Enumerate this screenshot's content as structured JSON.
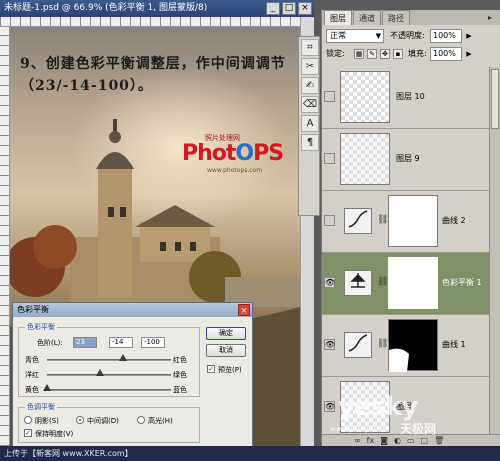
{
  "document": {
    "title": "未标题-1.psd @ 66.9% (色彩平衡 1, 图层蒙版/8)",
    "minimize": "_",
    "maximize": "□",
    "close": "×",
    "caption": "9、创建色彩平衡调整层，作中间调调节（23/-14-100）。",
    "logo_small": "照片处理网",
    "logo_prefix": "Phot",
    "logo_accent": "O",
    "logo_suffix": "PS",
    "logo_url": "www.photops.com"
  },
  "dialog": {
    "title": "色彩平衡",
    "close": "×",
    "balance_group": "色彩平衡",
    "levels_label": "色阶(L):",
    "levels": [
      "23",
      "-14",
      "-100"
    ],
    "sliders": [
      {
        "left": "青色",
        "right": "红色",
        "value": 23
      },
      {
        "left": "洋红",
        "right": "绿色",
        "value": -14
      },
      {
        "left": "黄色",
        "right": "蓝色",
        "value": -100
      }
    ],
    "ok": "确定",
    "cancel": "取消",
    "preview": "预览(P)",
    "tone_group": "色调平衡",
    "shadows": "阴影(S)",
    "midtones": "中间调(D)",
    "highlights": "高光(H)",
    "preserve": "保持明度(V)"
  },
  "tools": [
    "⌗",
    "✂",
    "✍",
    "⌫",
    "A",
    "¶"
  ],
  "panel": {
    "tabs": [
      "图层",
      "通道",
      "路径"
    ],
    "menu": "▸",
    "blend_mode": "正常",
    "opacity_label": "不透明度:",
    "opacity": "100%",
    "lock_label": "锁定:",
    "fill_label": "填充:",
    "fill": "100%",
    "layers": [
      {
        "name": "图层 10",
        "type": "pixel"
      },
      {
        "name": "图层 9",
        "type": "pixel"
      },
      {
        "name": "曲线 2",
        "type": "curves",
        "mask": "white"
      },
      {
        "name": "色彩平衡 1",
        "type": "balance",
        "mask": "white",
        "selected": true
      },
      {
        "name": "曲线 1",
        "type": "curves",
        "mask": "black"
      },
      {
        "name": "图层",
        "type": "pixel"
      }
    ],
    "footer_icons": [
      "∞",
      "fx",
      "◙",
      "◐",
      "▭",
      "▢",
      "🗑"
    ]
  },
  "status": {
    "text": "上传于【新客网 www.XKER.com】"
  },
  "watermark": {
    "brand": "yesky",
    "sub": "天极网",
    "url": "www.yesky.com"
  },
  "colors": {
    "accent": "#7f9166",
    "logo_red": "#d11a1f",
    "logo_blue": "#2c6fc8"
  }
}
